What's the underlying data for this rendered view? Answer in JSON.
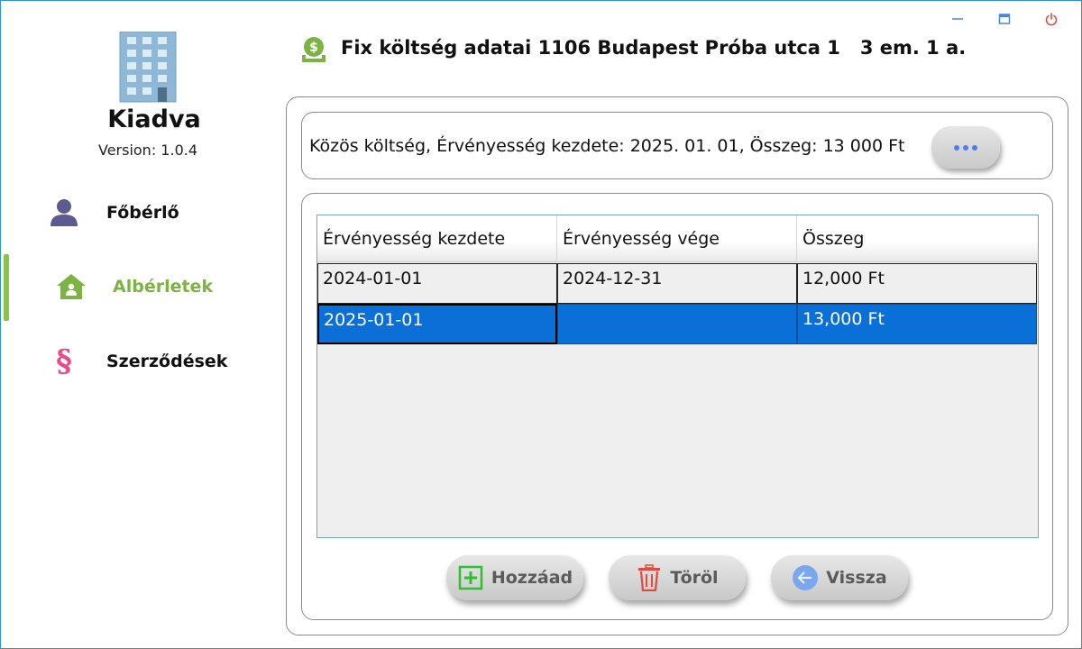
{
  "window": {
    "controls": [
      "minimize-icon",
      "maximize-icon",
      "power-icon"
    ]
  },
  "sidebar": {
    "app_name": "Kiadva",
    "version": "Version: 1.0.4",
    "items": [
      {
        "label": "Főbérlő",
        "icon": "user-icon",
        "color": "#5b5b8f"
      },
      {
        "label": "Albérletek",
        "icon": "home-icon",
        "color": "#7cb342",
        "active": true
      },
      {
        "label": "Szerződések",
        "icon": "paragraph-icon",
        "color": "#e84a8c"
      }
    ]
  },
  "header": {
    "title": "Fix költség adatai 1106 Budapest Próba utca 1   3 em. 1 a.",
    "icon": "money-icon"
  },
  "info": {
    "text": "Közös költség, Érvényesség kezdete: 2025. 01. 01, Összeg: 13 000 Ft",
    "more_button": "more-icon"
  },
  "table": {
    "columns": [
      "Érvényesség kezdete",
      "Érvényesség vége",
      "Összeg"
    ],
    "rows": [
      {
        "start": "2024-01-01",
        "end": "2024-12-31",
        "amount": "12,000 Ft",
        "selected": false
      },
      {
        "start": "2025-01-01",
        "end": "",
        "amount": "13,000 Ft",
        "selected": true
      }
    ]
  },
  "actions": {
    "add": "Hozzáad",
    "delete": "Töröl",
    "back": "Vissza"
  },
  "colors": {
    "accent_green": "#7cb342",
    "selection_blue": "#0a6fd6",
    "close_red": "#e04a3a"
  }
}
